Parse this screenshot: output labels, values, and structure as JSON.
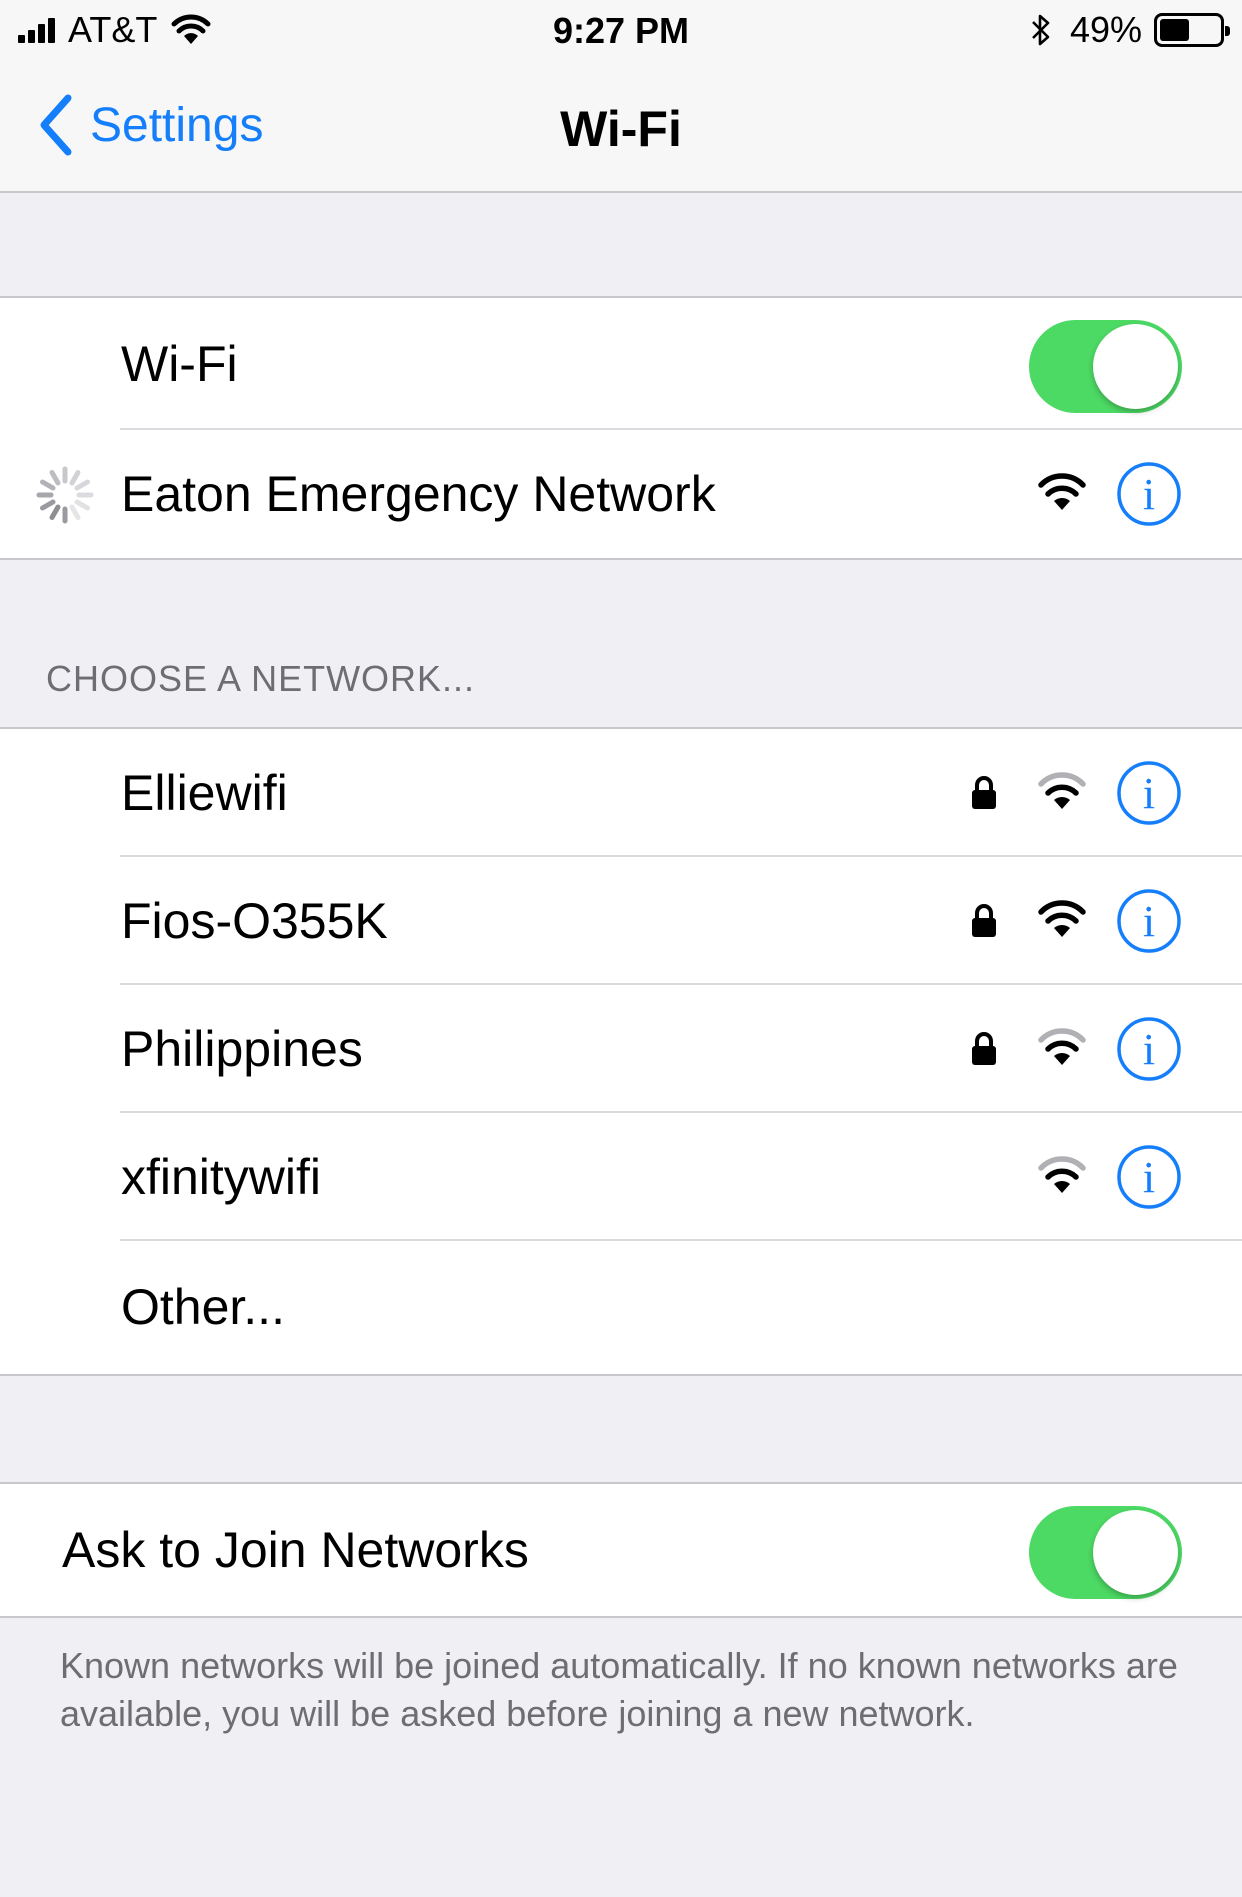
{
  "status_bar": {
    "carrier": "AT&T",
    "time": "9:27 PM",
    "battery_percent": "49%",
    "battery_level": 0.49,
    "icons": [
      "signal-bars-icon",
      "wifi-icon",
      "bluetooth-icon",
      "battery-icon"
    ]
  },
  "nav": {
    "back_label": "Settings",
    "title": "Wi-Fi"
  },
  "wifi_toggle": {
    "label": "Wi-Fi",
    "on": true
  },
  "connected": {
    "name": "Eaton Emergency Network",
    "connecting": true
  },
  "section_header": "CHOOSE A NETWORK...",
  "networks": [
    {
      "name": "Elliewifi",
      "locked": true
    },
    {
      "name": "Fios-O355K",
      "locked": true
    },
    {
      "name": "Philippines",
      "locked": true
    },
    {
      "name": "xfinitywifi",
      "locked": false
    }
  ],
  "other_label": "Other...",
  "ask_to_join": {
    "label": "Ask to Join Networks",
    "on": true,
    "footer": "Known networks will be joined automatically. If no known networks are available, you will be asked before joining a new network."
  },
  "colors": {
    "accent": "#147efb",
    "toggle_on": "#4cd964",
    "background": "#efeff4",
    "secondary_text": "#6d6d72"
  }
}
